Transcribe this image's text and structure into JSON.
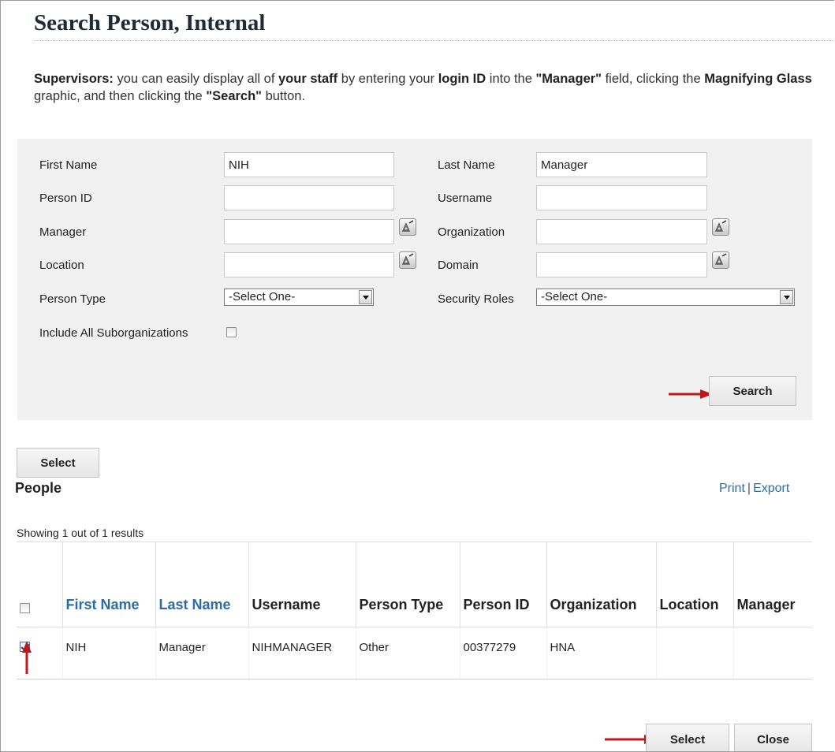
{
  "page": {
    "title": "Search Person, Internal",
    "instructions": {
      "p1": "Supervisors:",
      "p2": " you can easily display all of ",
      "p3": "your staff",
      "p4": " by entering your ",
      "p5": "login ID",
      "p6": " into the ",
      "p7": "\"Manager\"",
      "p8": " field, clicking the ",
      "p9": "Magnifying Glass",
      "p10": " graphic, and then clicking the ",
      "p11": "\"Search\"",
      "p12": " button."
    }
  },
  "search_form": {
    "first_name": {
      "label": "First Name",
      "value": "NIH"
    },
    "last_name": {
      "label": "Last Name",
      "value": "Manager"
    },
    "person_id": {
      "label": "Person ID",
      "value": ""
    },
    "username": {
      "label": "Username",
      "value": ""
    },
    "manager": {
      "label": "Manager",
      "value": ""
    },
    "organization": {
      "label": "Organization",
      "value": ""
    },
    "location": {
      "label": "Location",
      "value": ""
    },
    "domain": {
      "label": "Domain",
      "value": ""
    },
    "person_type": {
      "label": "Person Type",
      "selected": "-Select One-"
    },
    "security_roles": {
      "label": "Security Roles",
      "selected": "-Select One-"
    },
    "include_suborgs": {
      "label": "Include All Suborganizations",
      "checked": false
    },
    "search_button": "Search"
  },
  "people": {
    "select_top_label": "Select",
    "heading": "People",
    "print_label": "Print",
    "separator": "|",
    "export_label": "Export",
    "results_count": "Showing 1 out of 1 results",
    "columns": [
      "First Name",
      "Last Name",
      "Username",
      "Person Type",
      "Person ID",
      "Organization",
      "Location",
      "Manager"
    ],
    "sortable_columns": [
      "First Name",
      "Last Name"
    ],
    "rows": [
      {
        "checked": true,
        "first_name": "NIH",
        "last_name": "Manager",
        "username": "NIHMANAGER",
        "person_type": "Other",
        "person_id": "00377279",
        "organization": "HNA",
        "location": "",
        "manager": ""
      }
    ]
  },
  "footer": {
    "select_label": "Select",
    "close_label": "Close"
  },
  "icons": {
    "picker": "magnifier-picker-icon",
    "annotation_arrow": "red-arrow-icon"
  },
  "colors": {
    "link": "#2d6ca8",
    "panel_bg": "#f1f1f1",
    "annotation_arrow": "#c0171b"
  }
}
